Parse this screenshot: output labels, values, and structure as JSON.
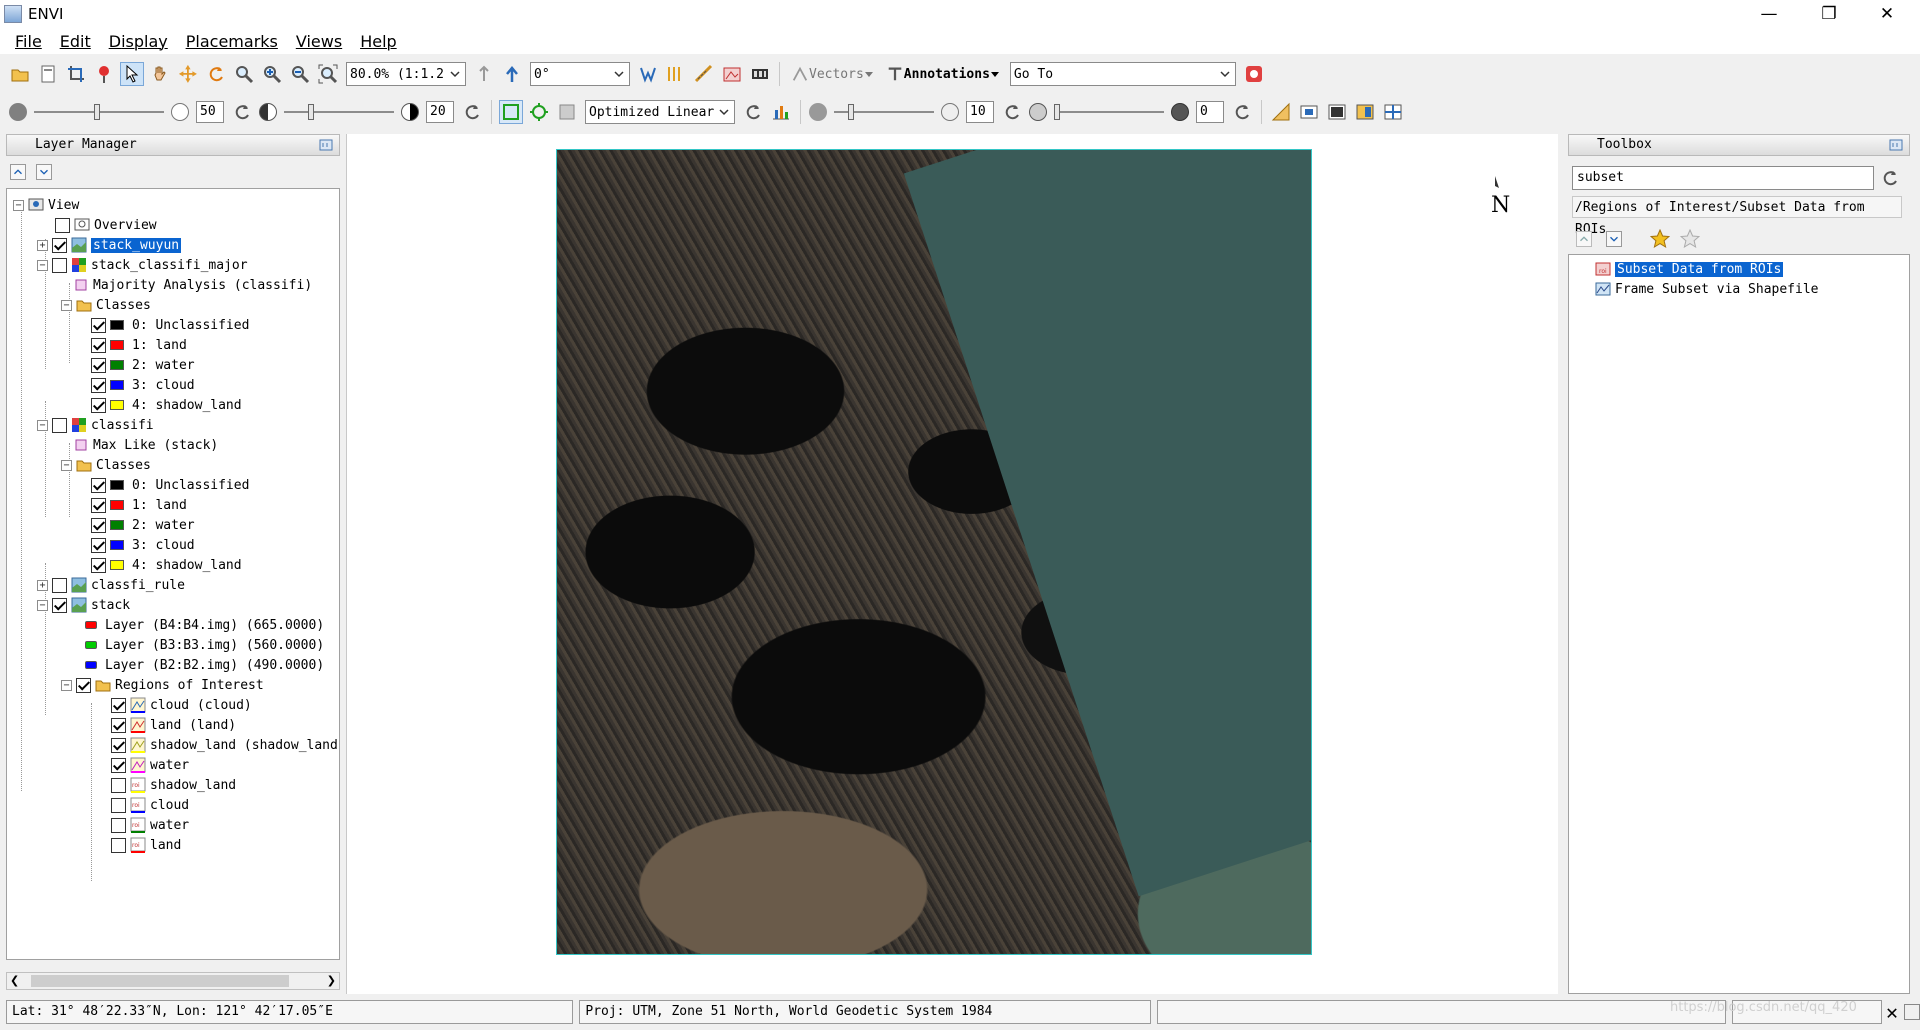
{
  "window": {
    "title": "ENVI",
    "controls": [
      "—",
      "❐",
      "✕"
    ]
  },
  "menus": [
    "File",
    "Edit",
    "Display",
    "Placemarks",
    "Views",
    "Help"
  ],
  "toolbar1": {
    "zoom_value": "80.0% (1:1.2",
    "rotation_value": "0°",
    "vectors_label": "Vectors",
    "annotations_label": "Annotations",
    "goto_value": "Go To"
  },
  "toolbar2": {
    "brightness_value": "50",
    "contrast_value": "20",
    "stretch_value": "Optimized Linear",
    "sharpen_value": "10",
    "transparency_value": "0"
  },
  "layer_manager": {
    "title": "Layer Manager",
    "rows": [
      {
        "label": "View"
      },
      {
        "label": "Overview"
      },
      {
        "label": "stack_wuyun"
      },
      {
        "label": "stack_classifi_major"
      },
      {
        "label": "Majority Analysis (classifi)"
      },
      {
        "label": "Classes"
      },
      {
        "label": "0: Unclassified",
        "color": "#000000"
      },
      {
        "label": "1: land",
        "color": "#ff0000"
      },
      {
        "label": "2: water",
        "color": "#008000"
      },
      {
        "label": "3: cloud",
        "color": "#0000ff"
      },
      {
        "label": "4: shadow_land",
        "color": "#ffff00"
      },
      {
        "label": "classifi"
      },
      {
        "label": "Max Like (stack)"
      },
      {
        "label": "Classes"
      },
      {
        "label": "0: Unclassified",
        "color": "#000000"
      },
      {
        "label": "1: land",
        "color": "#ff0000"
      },
      {
        "label": "2: water",
        "color": "#008000"
      },
      {
        "label": "3: cloud",
        "color": "#0000ff"
      },
      {
        "label": "4: shadow_land",
        "color": "#ffff00"
      },
      {
        "label": "classfi_rule"
      },
      {
        "label": "stack"
      },
      {
        "label": "Layer (B4:B4.img) (665.0000)",
        "color": "#ff0000"
      },
      {
        "label": "Layer (B3:B3.img) (560.0000)",
        "color": "#00cc00"
      },
      {
        "label": "Layer (B2:B2.img) (490.0000)",
        "color": "#0000ff"
      },
      {
        "label": "Regions of Interest"
      },
      {
        "label": "cloud (cloud)"
      },
      {
        "label": "land (land)"
      },
      {
        "label": "shadow_land (shadow_land)"
      },
      {
        "label": "water"
      },
      {
        "label": "shadow_land"
      },
      {
        "label": "cloud"
      },
      {
        "label": "water"
      },
      {
        "label": "land"
      }
    ]
  },
  "toolbox": {
    "title": "Toolbox",
    "search_value": "subset",
    "path": "/Regions of Interest/Subset Data from ROIs",
    "items": [
      "Subset Data from ROIs",
      "Frame Subset via Shapefile"
    ]
  },
  "north_label": "N",
  "status": {
    "coords": "Lat: 31° 48′22.33″N, Lon: 121° 42′17.05″E",
    "projection": "Proj: UTM, Zone 51 North, World Geodetic System 1984",
    "extra": ""
  },
  "watermark": "https://blog.csdn.net/qq_420"
}
